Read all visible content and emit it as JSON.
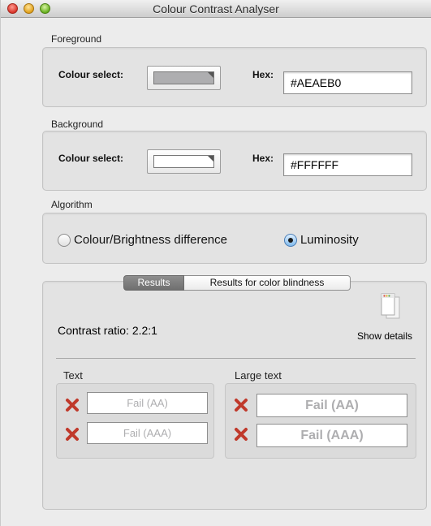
{
  "window": {
    "title": "Colour Contrast Analyser"
  },
  "foreground": {
    "section_label": "Foreground",
    "colour_select_label": "Colour select:",
    "swatch_color": "#AEAEB0",
    "hex_label": "Hex:",
    "hex_value": "#AEAEB0"
  },
  "background": {
    "section_label": "Background",
    "colour_select_label": "Colour select:",
    "swatch_color": "#FFFFFF",
    "hex_label": "Hex:",
    "hex_value": "#FFFFFF"
  },
  "algorithm": {
    "section_label": "Algorithm",
    "options": [
      {
        "label": "Colour/Brightness difference",
        "selected": false
      },
      {
        "label": "Luminosity",
        "selected": true
      }
    ]
  },
  "results": {
    "tabs": [
      {
        "label": "Results",
        "active": true
      },
      {
        "label": "Results for color blindness",
        "active": false
      }
    ],
    "contrast_ratio": "Contrast ratio: 2.2:1",
    "show_details_label": "Show details",
    "text": {
      "label": "Text",
      "aa": "Fail (AA)",
      "aaa": "Fail (AAA)"
    },
    "large_text": {
      "label": "Large text",
      "aa": "Fail (AA)",
      "aaa": "Fail (AAA)"
    },
    "status_icon": "fail-cross-icon",
    "fail_color": "#C0392B",
    "result_text_color": "#AEAEB0"
  }
}
